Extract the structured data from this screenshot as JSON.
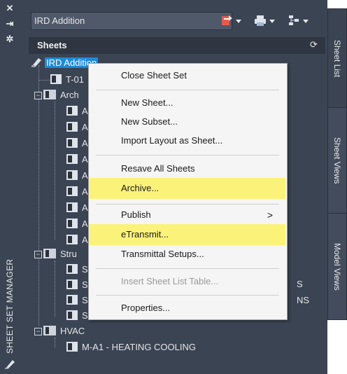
{
  "palette": {
    "title": "SHEET SET MANAGER"
  },
  "toolbar": {
    "sheet_set_value": "IRD Addition"
  },
  "sheets_panel": {
    "header": "Sheets"
  },
  "tree": {
    "root": "IRD Addition",
    "t01": "T-01",
    "arch": "Arch",
    "arch_items": [
      "A",
      "A",
      "A",
      "A",
      "A",
      "A",
      "A",
      "A",
      "A"
    ],
    "struct": "Stru",
    "struct_items": [
      "S",
      "S",
      "S",
      "S"
    ],
    "struct_suffix_2": "S",
    "struct_suffix_3": "NS",
    "hvac": "HVAC",
    "hvac_sheet": "M-A1 - HEATING COOLING"
  },
  "right_tabs": {
    "sheet_list": "Sheet List",
    "sheet_views": "Sheet Views",
    "model_views": "Model Views"
  },
  "context_menu": {
    "close_sheet_set": "Close Sheet Set",
    "new_sheet": "New Sheet...",
    "new_subset": "New Subset...",
    "import_layout": "Import Layout as Sheet...",
    "resave_all": "Resave All Sheets",
    "archive": "Archive...",
    "publish": "Publish",
    "etransmit": "eTransmit...",
    "transmittal_setups": "Transmittal Setups...",
    "insert_sheet_list_table": "Insert Sheet List Table...",
    "properties": "Properties...",
    "submenu_arrow": ">"
  },
  "colors": {
    "panel_bg": "#3b4453",
    "highlight": "#fbf27a",
    "selection": "#1f8ad6",
    "menu_bg": "#f5f5f5"
  }
}
